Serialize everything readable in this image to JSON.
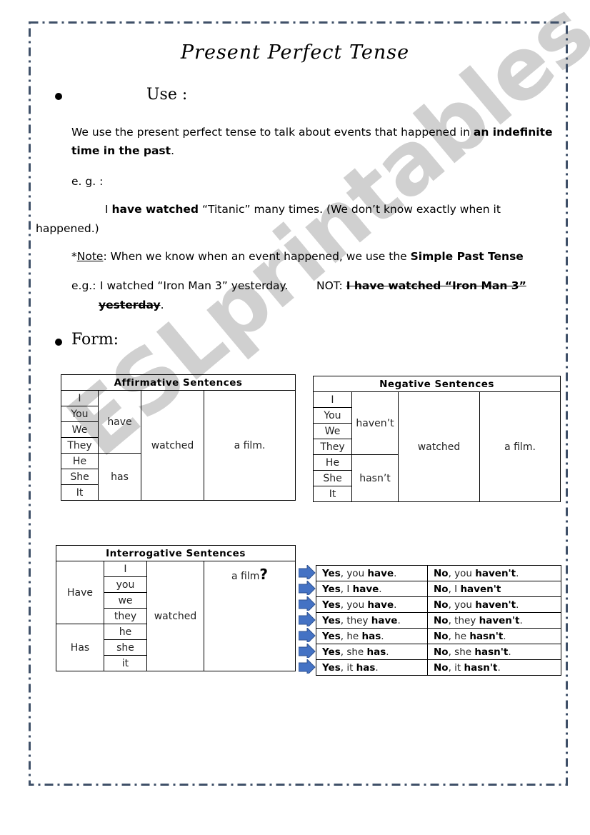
{
  "title": "Present Perfect Tense",
  "use": {
    "heading": "Use :",
    "definition_pre": "We use the present perfect tense to talk about events that happened in ",
    "definition_bold": "an indefinite",
    "definition_bold2": "time in the past",
    "definition_post": ".",
    "eg_label": "e. g. :",
    "example_pre": "I ",
    "example_bold": "have watched",
    "example_post": " “Titanic” many times.  (We don’t know exactly when it",
    "example_wrap": "happened.)",
    "note_star": "*",
    "note_label": "Note",
    "note_text": ": When we know when an event happened, we use the ",
    "note_bold": "Simple Past Tense",
    "eg2_label": "e.g.:",
    "eg2_text": "I watched “Iron Man 3” yesterday.",
    "not_label": "NOT: ",
    "not_strike": "I have watched “Iron Man 3”",
    "not_strike_wrap": "yesterday",
    "not_end": "."
  },
  "form": {
    "heading": "Form:"
  },
  "affirmative": {
    "header": "Affirmative Sentences",
    "subjects": [
      "I",
      "You",
      "We",
      "They",
      "He",
      "She",
      "It"
    ],
    "aux_plural": "have",
    "aux_singular": "has",
    "verb": "watched",
    "object": "a film."
  },
  "negative": {
    "header": "Negative Sentences",
    "subjects": [
      "I",
      "You",
      "We",
      "They",
      "He",
      "She",
      "It"
    ],
    "aux_plural": "haven’t",
    "aux_singular": "hasn’t",
    "verb": "watched",
    "object": "a film."
  },
  "interrogative": {
    "header": "Interrogative Sentences",
    "aux_plural": "Have",
    "aux_singular": "Has",
    "subjects": [
      "I",
      "you",
      "we",
      "they",
      "he",
      "she",
      "it"
    ],
    "verb": "watched",
    "object": "a film",
    "qmark": "?"
  },
  "answers": [
    {
      "yes": "Yes",
      "yes_mid": ", you ",
      "yes_aux": "have",
      "yes_end": ".",
      "no": "No",
      "no_mid": ", you ",
      "no_aux": "haven't",
      "no_end": "."
    },
    {
      "yes": "Yes",
      "yes_mid": ", I ",
      "yes_aux": "have",
      "yes_end": ".",
      "no": "No",
      "no_mid": ", I ",
      "no_aux": "haven't",
      "no_end": ""
    },
    {
      "yes": "Yes",
      "yes_mid": ", you ",
      "yes_aux": "have",
      "yes_end": ".",
      "no": "No",
      "no_mid": ", you ",
      "no_aux": "haven't",
      "no_end": "."
    },
    {
      "yes": "Yes",
      "yes_mid": ", they ",
      "yes_aux": "have",
      "yes_end": ".",
      "no": "No",
      "no_mid": ", they ",
      "no_aux": "haven't",
      "no_end": "."
    },
    {
      "yes": "Yes",
      "yes_mid": ", he ",
      "yes_aux": "has",
      "yes_end": ".",
      "no": "No",
      "no_mid": ", he ",
      "no_aux": "hasn't",
      "no_end": "."
    },
    {
      "yes": "Yes",
      "yes_mid": ", she ",
      "yes_aux": "has",
      "yes_end": ".",
      "no": "No",
      "no_mid": ", she ",
      "no_aux": "hasn't",
      "no_end": "."
    },
    {
      "yes": "Yes",
      "yes_mid": ", it ",
      "yes_aux": "has",
      "yes_end": ".",
      "no": "No",
      "no_mid": ", it ",
      "no_aux": "hasn't",
      "no_end": "."
    }
  ],
  "icons": {
    "bullet": "bullet-icon",
    "arrow": "right-arrow-icon"
  },
  "colors": {
    "frame": "#3f5068",
    "arrow": "#4472c4",
    "arrow_edge": "#2f528f",
    "watermark": "#aaaaaa"
  },
  "watermark": "ESLprintables.com"
}
